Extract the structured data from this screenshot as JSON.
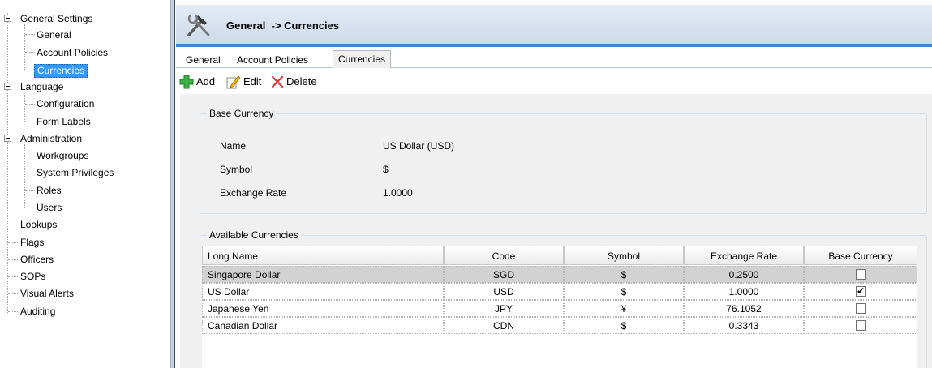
{
  "tree": {
    "items": [
      {
        "label": "General Settings"
      },
      {
        "label": "General"
      },
      {
        "label": "Account Policies"
      },
      {
        "label": "Currencies"
      },
      {
        "label": "Language"
      },
      {
        "label": "Configuration"
      },
      {
        "label": "Form Labels"
      },
      {
        "label": "Administration"
      },
      {
        "label": "Workgroups"
      },
      {
        "label": "System Privileges"
      },
      {
        "label": "Roles"
      },
      {
        "label": "Users"
      },
      {
        "label": "Lookups"
      },
      {
        "label": "Flags"
      },
      {
        "label": "Officers"
      },
      {
        "label": "SOPs"
      },
      {
        "label": "Visual Alerts"
      },
      {
        "label": "Auditing"
      }
    ],
    "selected": "Currencies"
  },
  "header": {
    "title": "General  -> Currencies",
    "icon": "tools-icon"
  },
  "tabs": [
    {
      "label": "General"
    },
    {
      "label": "Account Policies"
    },
    {
      "label": "Currencies"
    }
  ],
  "toolbar": {
    "add_label": "Add",
    "edit_label": "Edit",
    "delete_label": "Delete"
  },
  "base_currency": {
    "legend": "Base Currency",
    "name_label": "Name",
    "name_value": "US Dollar (USD)",
    "symbol_label": "Symbol",
    "symbol_value": "$",
    "rate_label": "Exchange Rate",
    "rate_value": "1.0000"
  },
  "available": {
    "legend": "Available Currencies",
    "columns": [
      "Long Name",
      "Code",
      "Symbol",
      "Exchange Rate",
      "Base Currency"
    ],
    "rows": [
      {
        "name": "Singapore Dollar",
        "code": "SGD",
        "symbol": "$",
        "rate": "0.2500",
        "base": false
      },
      {
        "name": "US Dollar",
        "code": "USD",
        "symbol": "$",
        "rate": "1.0000",
        "base": true
      },
      {
        "name": "Japanese Yen",
        "code": "JPY",
        "symbol": "¥",
        "rate": "76.1052",
        "base": false
      },
      {
        "name": "Canadian Dollar",
        "code": "CDN",
        "symbol": "$",
        "rate": "0.3343",
        "base": false
      }
    ]
  },
  "colors": {
    "selection": "#3399ff",
    "header_accent": "#4f81bd",
    "add_icon": "#3cb043",
    "delete_icon": "#e03030"
  }
}
